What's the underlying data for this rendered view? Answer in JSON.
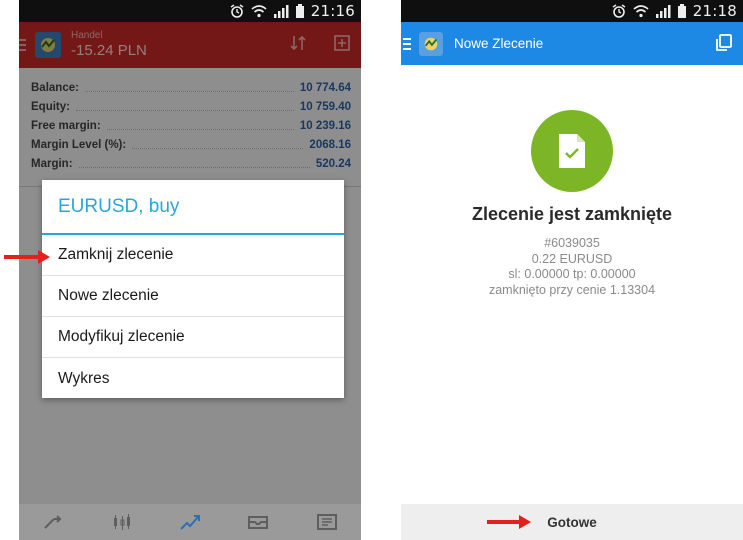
{
  "left_phone": {
    "status_time": "21:16",
    "header": {
      "small_title": "Handel",
      "balance_display": "-15.24 PLN"
    },
    "account": [
      {
        "label": "Balance:",
        "value": "10 774.64"
      },
      {
        "label": "Equity:",
        "value": "10 759.40"
      },
      {
        "label": "Free margin:",
        "value": "10 239.16"
      },
      {
        "label": "Margin Level (%):",
        "value": "2068.16"
      },
      {
        "label": "Margin:",
        "value": "520.24"
      }
    ],
    "dialog": {
      "title": "EURUSD, buy",
      "items": [
        "Zamknij zlecenie",
        "Nowe zlecenie",
        "Modyfikuj zlecenie",
        "Wykres"
      ]
    }
  },
  "right_phone": {
    "status_time": "21:18",
    "header_title": "Nowe Zlecenie",
    "heading": "Zlecenie jest zamknięte",
    "details": [
      "#6039035",
      "0.22 EURUSD",
      "sl: 0.00000 tp: 0.00000",
      "zamknięto przy cenie 1.13304"
    ],
    "done_label": "Gotowe"
  },
  "colors": {
    "trade_header": "#c62828",
    "order_header": "#1e88e5",
    "dialog_accent": "#2aa6d9",
    "success_green": "#7cb526",
    "arrow_red": "#e3201b",
    "value_blue": "#2d5fa8"
  },
  "icons": {
    "status": [
      "alarm-icon",
      "wifi-icon",
      "signal-icon",
      "battery-icon"
    ],
    "left_header": [
      "sort-icon",
      "add-order-icon"
    ],
    "bottom_nav": [
      "quotes-icon",
      "chart-candles-icon",
      "trade-icon",
      "history-icon",
      "news-icon"
    ],
    "right_header": [
      "copy-icon"
    ],
    "success": "document-check-icon"
  }
}
